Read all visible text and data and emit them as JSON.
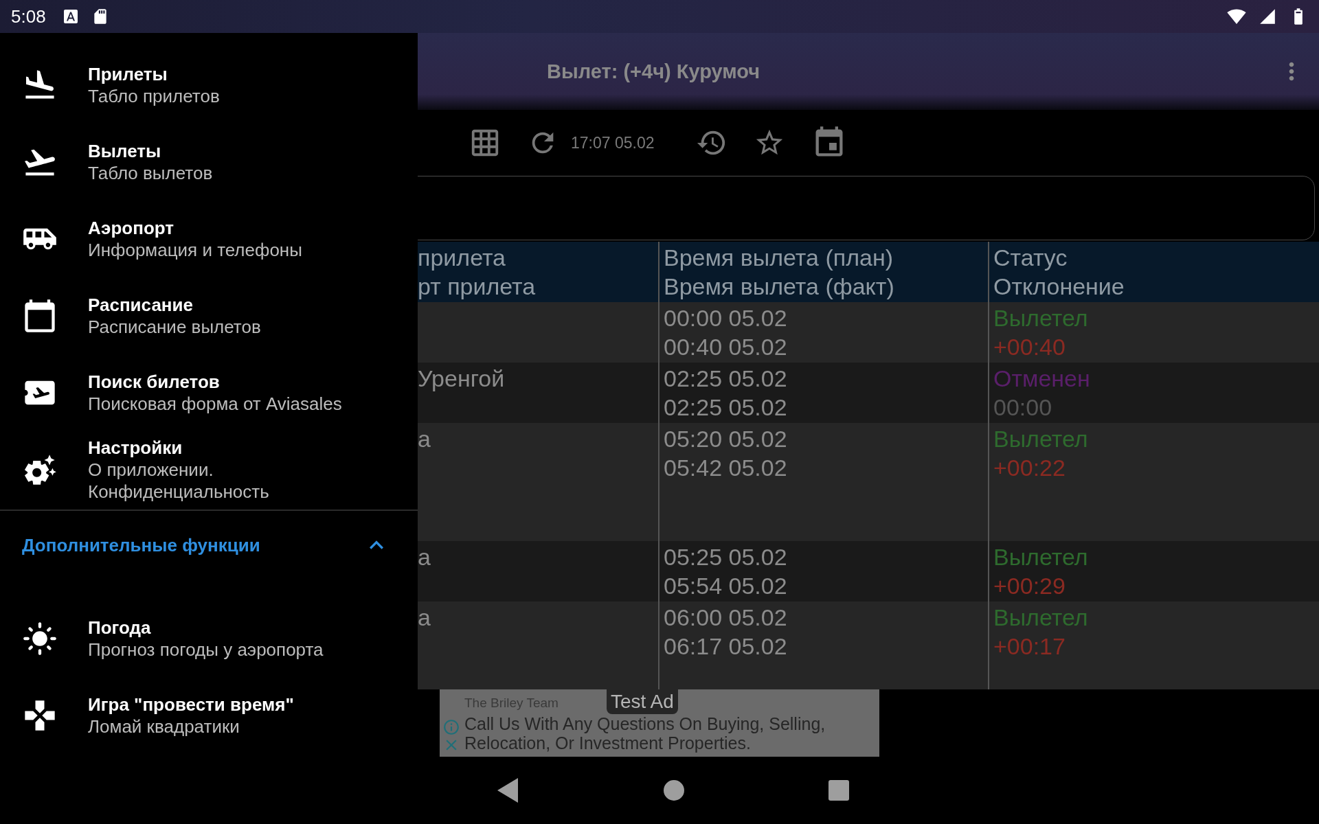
{
  "status_bar": {
    "time": "5:08"
  },
  "app_bar": {
    "title": "Вылет: (+4ч) Курумоч"
  },
  "toolbar": {
    "updated": "17:07 05.02"
  },
  "table": {
    "columns": [
      {
        "lines": [
          "прилета",
          "рт прилета"
        ]
      },
      {
        "lines": [
          "Время вылета (план)",
          "Время вылета (факт)"
        ]
      },
      {
        "lines": [
          "Статус",
          "Отклонение"
        ]
      }
    ],
    "rows": [
      {
        "place": "",
        "times": [
          "00:00 05.02",
          "00:40 05.02"
        ],
        "status": {
          "text": "Вылетел",
          "color": "#2e6b2e"
        },
        "deviation": {
          "text": "+00:40",
          "color": "#8b2a22"
        }
      },
      {
        "place": " Уренгой",
        "times": [
          "02:25 05.02",
          "02:25 05.02"
        ],
        "status": {
          "text": "Отменен",
          "color": "#5a1f6a"
        },
        "deviation": {
          "text": "00:00",
          "color": "#555555"
        }
      },
      {
        "place": "а",
        "times": [
          "05:20 05.02",
          "05:42 05.02"
        ],
        "status": {
          "text": "Вылетел",
          "color": "#2e6b2e"
        },
        "deviation": {
          "text": "+00:22",
          "color": "#8b2a22"
        }
      },
      {
        "place": "а",
        "times": [
          "05:25 05.02",
          "05:54 05.02"
        ],
        "status": {
          "text": "Вылетел",
          "color": "#2e6b2e"
        },
        "deviation": {
          "text": "+00:29",
          "color": "#8b2a22"
        }
      },
      {
        "place": "а",
        "times": [
          "06:00 05.02",
          "06:17 05.02"
        ],
        "status": {
          "text": "Вылетел",
          "color": "#2e6b2e"
        },
        "deviation": {
          "text": "+00:17",
          "color": "#8b2a22"
        }
      }
    ]
  },
  "ad": {
    "label": "Test Ad",
    "advertiser": "The Briley Team",
    "lines": [
      "Call Us With Any Questions On Buying, Selling,",
      "Relocation, Or Investment Properties."
    ]
  },
  "drawer": {
    "items": [
      {
        "title": "Прилеты",
        "subtitle": [
          "Табло прилетов"
        ]
      },
      {
        "title": "Вылеты",
        "subtitle": [
          "Табло вылетов"
        ]
      },
      {
        "title": "Аэропорт",
        "subtitle": [
          "Информация и телефоны"
        ]
      },
      {
        "title": "Расписание",
        "subtitle": [
          "Расписание вылетов"
        ]
      },
      {
        "title": "Поиск билетов",
        "subtitle": [
          "Поисковая форма от Aviasales"
        ]
      },
      {
        "title": "Настройки",
        "subtitle": [
          "О приложении.",
          "Конфиденциальность"
        ]
      }
    ],
    "section": {
      "label": "Дополнительные функции",
      "expanded": true
    },
    "extra_items": [
      {
        "title": "Погода",
        "subtitle": [
          "Прогноз погоды у аэропорта"
        ]
      },
      {
        "title": "Игра \"провести время\"",
        "subtitle": [
          "Ломай квадратики"
        ]
      }
    ]
  }
}
